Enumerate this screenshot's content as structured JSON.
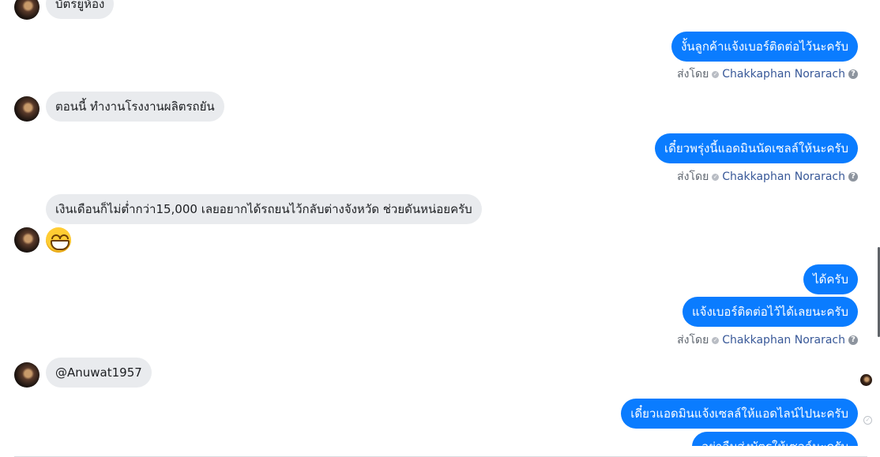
{
  "messages": [
    {
      "id": "m1",
      "side": "in",
      "text": "บัตรยูห้อง"
    },
    {
      "id": "m2",
      "side": "out",
      "text": "งั้นลูกค้าแจ้งเบอร์ติดต่อไว้นะครับ"
    },
    {
      "id": "m3",
      "side": "in",
      "text": "ตอนนี้ ทำงานโรงงานผลิตรถยัน"
    },
    {
      "id": "m4",
      "side": "out",
      "text": "เดี๋ยวพรุ่งนี้แอดมินนัดเซลล์ให้นะครับ"
    },
    {
      "id": "m5",
      "side": "in",
      "text": "เงินเดือนก็ไม่ต่ำกว่า15,000 เลยอยากได้รถยนไว้กลับต่างจังหวัด ช่วยดันหน่อยครับ"
    },
    {
      "id": "m6",
      "side": "in",
      "emoji": "grinning-face-emoji"
    },
    {
      "id": "m7",
      "side": "out",
      "text": "ได้ครับ"
    },
    {
      "id": "m8",
      "side": "out",
      "text": "แจ้งเบอร์ติดต่อไว้ได้เลยนะครับ"
    },
    {
      "id": "m9",
      "side": "in",
      "text": "@Anuwat1957"
    },
    {
      "id": "m10",
      "side": "out",
      "text": "เดี๋ยวแอดมินแจ้งเซลล์ให้แอดไลน์ไปนะครับ"
    },
    {
      "id": "m11",
      "side": "out",
      "text": "อย่าลืมส่งบัตรให้เซลล์นะครับ"
    }
  ],
  "sent_by": {
    "prefix": "ส่งโดย",
    "sender": "Chakkaphan Norarach",
    "help_icon": "question-icon",
    "verified_icon": "check-badge-icon"
  },
  "colors": {
    "outgoing_bubble": "#0a7cff",
    "incoming_bubble": "#e9ebee",
    "sender_link": "#385898"
  }
}
